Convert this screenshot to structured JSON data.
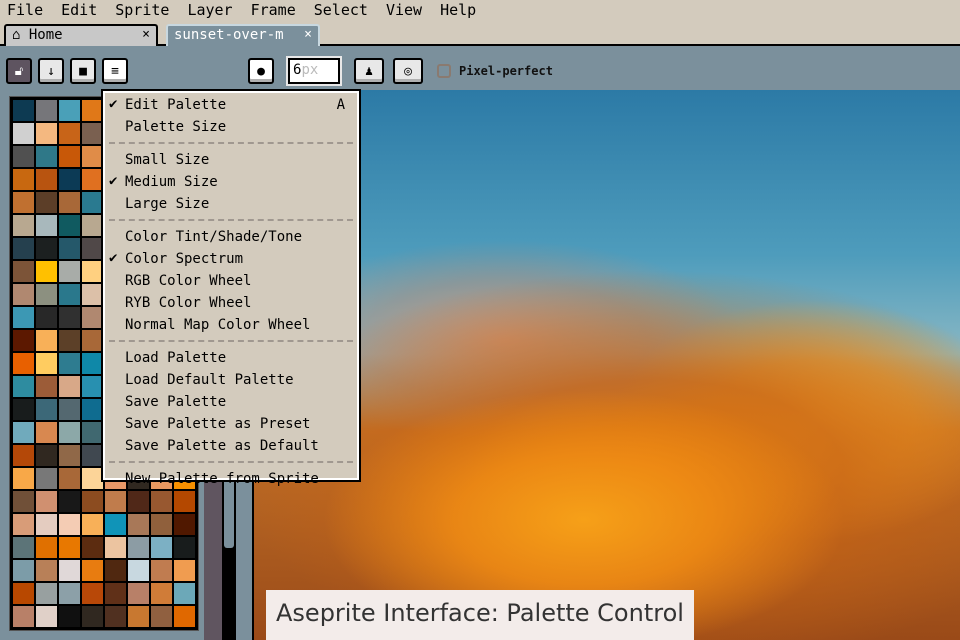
{
  "menubar": [
    "File",
    "Edit",
    "Sprite",
    "Layer",
    "Frame",
    "Select",
    "View",
    "Help"
  ],
  "tabs": {
    "home": "Home",
    "file": "sunset-over-m",
    "close": "×"
  },
  "toolbar": {
    "brush_size": "6",
    "brush_unit": "px",
    "pixel_perfect": "Pixel-perfect"
  },
  "menu": [
    {
      "label": "Edit Palette",
      "checked": true,
      "shortcut": "A"
    },
    {
      "label": "Palette Size"
    },
    "sep",
    {
      "label": "Small Size"
    },
    {
      "label": "Medium Size",
      "checked": true
    },
    {
      "label": "Large Size"
    },
    "sep",
    {
      "label": "Color Tint/Shade/Tone"
    },
    {
      "label": "Color Spectrum",
      "checked": true
    },
    {
      "label": "RGB Color Wheel"
    },
    {
      "label": "RYB Color Wheel"
    },
    {
      "label": "Normal Map Color Wheel"
    },
    "sep",
    {
      "label": "Load Palette"
    },
    {
      "label": "Load Default Palette"
    },
    {
      "label": "Save Palette"
    },
    {
      "label": "Save Palette as Preset"
    },
    {
      "label": "Save Palette as Default"
    },
    "sep",
    {
      "label": "New Palette from Sprite"
    }
  ],
  "caption": "Aseprite Interface: Palette Control",
  "palette": [
    "#0d3a52",
    "#76767a",
    "#4aa0b8",
    "#e07818",
    "#e07818",
    "#c86418",
    "#2a7a90",
    "#e89860",
    "#d0d0d0",
    "#f4b880",
    "#c86418",
    "#7a6050",
    "#b8a890",
    "#505050",
    "#a86838",
    "#f89000",
    "#505050",
    "#2f7888",
    "#c85808",
    "#e08c48",
    "#303030",
    "#8c4c20",
    "#c07c4c",
    "#b44800",
    "#c86810",
    "#b85410",
    "#0c3a55",
    "#e07020",
    "#e89868",
    "#302820",
    "#e89860",
    "#501800",
    "#c07030",
    "#5c3e28",
    "#a86838",
    "#2a7a90",
    "#7cb0c4",
    "#181c1c",
    "#c07c50",
    "#f09c50",
    "#b8a890",
    "#a8b8bc",
    "#105a60",
    "#b8a890",
    "#603018",
    "#b88068",
    "#d07c38",
    "#6ca8b8",
    "#25404e",
    "#1c2020",
    "#25586a",
    "#504848",
    "#2e7c90",
    "#9c5c38",
    "#d8a888",
    "#2890b0",
    "#7c5438",
    "#ffc000",
    "#a8aca8",
    "#ffd080",
    "#0f88a8",
    "#5c4028",
    "#906048",
    "#a86838",
    "#b08870",
    "#8c9080",
    "#2a788c",
    "#dcc0a8",
    "#f8b058",
    "#e86000",
    "#3c6878",
    "#546870",
    "#3c98b4",
    "#282828",
    "#303030",
    "#b08870",
    "#906848",
    "#404850",
    "#70aabc",
    "#d88850",
    "#5c1800",
    "#f8b058",
    "#5c4028",
    "#a86838",
    "#8ca8a8",
    "#406870",
    "#b44808",
    "#302820",
    "#e86000",
    "#ffcc60",
    "#2e7c90",
    "#0f88a8",
    "#c07030",
    "#f4b880",
    "#2a788c",
    "#e07818",
    "#2e8ca0",
    "#9c5c38",
    "#d8a888",
    "#2890b0",
    "#5c3e28",
    "#e08c48",
    "#ffd080",
    "#c85808",
    "#181c1c",
    "#3c6878",
    "#546870",
    "#0f6c90",
    "#b85410",
    "#7a6050",
    "#dcc0a8",
    "#4aa0b8",
    "#70aabc",
    "#d88850",
    "#8ca8a8",
    "#406870",
    "#f8a848",
    "#c86810",
    "#302820",
    "#b08870",
    "#b44808",
    "#302820",
    "#906848",
    "#404850",
    "#e07020",
    "#0d3a52",
    "#76767a",
    "#e08c48",
    "#f8a848",
    "#787878",
    "#a86838",
    "#fcd498",
    "#e89868",
    "#302820",
    "#e89860",
    "#f89000",
    "#705038",
    "#d09070",
    "#181818",
    "#8c4c20",
    "#c07c4c",
    "#502818",
    "#985830",
    "#b44800",
    "#d89c78",
    "#e4ccc0",
    "#f4ccb4",
    "#f8b058",
    "#1094b8",
    "#a87858",
    "#90603c",
    "#501800",
    "#5c7478",
    "#e07000",
    "#e87800",
    "#5c2c10",
    "#ecc4a0",
    "#8c9ca4",
    "#7cb0c4",
    "#181c1c",
    "#7c9ca8",
    "#b88058",
    "#e0d8d8",
    "#e87c10",
    "#502810",
    "#c8d8e0",
    "#c07c50",
    "#f09c50",
    "#b84800",
    "#98a0a0",
    "#8ca0a8",
    "#b84808",
    "#603018",
    "#b88068",
    "#d07c38",
    "#6ca8b8",
    "#b88068",
    "#e0d0c8",
    "#101010",
    "#302820",
    "#503020",
    "#c87830",
    "#906040",
    "#e06800"
  ]
}
